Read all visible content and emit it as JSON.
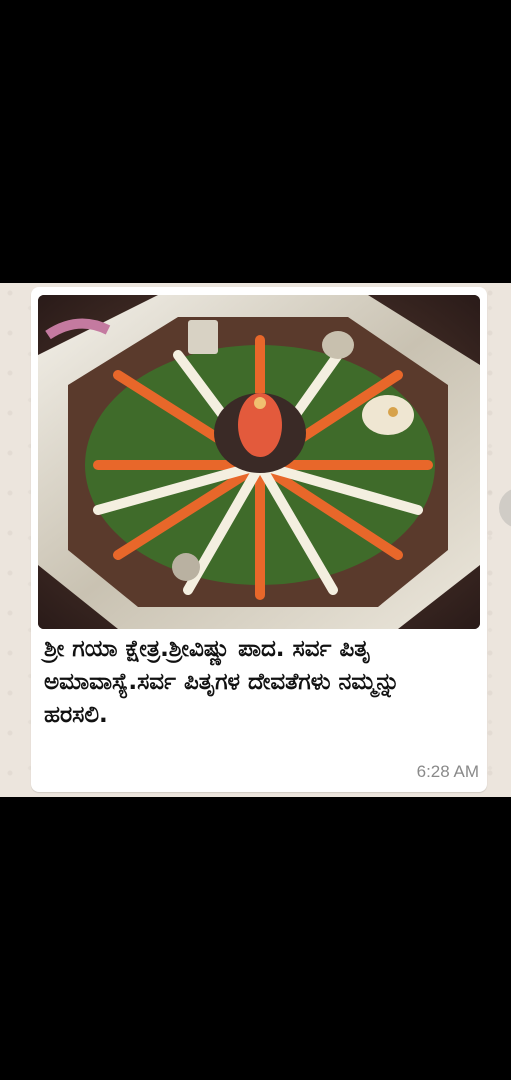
{
  "message": {
    "caption": "ಶ್ರೀ ಗಯಾ ಕ್ಷೇತ್ರ.ಶ್ರೀವಿಷ್ಣು ಪಾದ. ಸರ್ವ ಪಿತೃ ಅಮಾವಾಸ್ಯೆ.ಸರ್ವ ಪಿತೃಗಳ ದೇವತೆಗಳು ನಮ್ಮನ್ನು ಹರಸಲಿ.",
    "time": "6:28 AM",
    "image_icon": "image-icon"
  },
  "colors": {
    "chat_background": "#ece5dd",
    "bubble": "#ffffff",
    "timestamp": "#8a8a8a"
  }
}
